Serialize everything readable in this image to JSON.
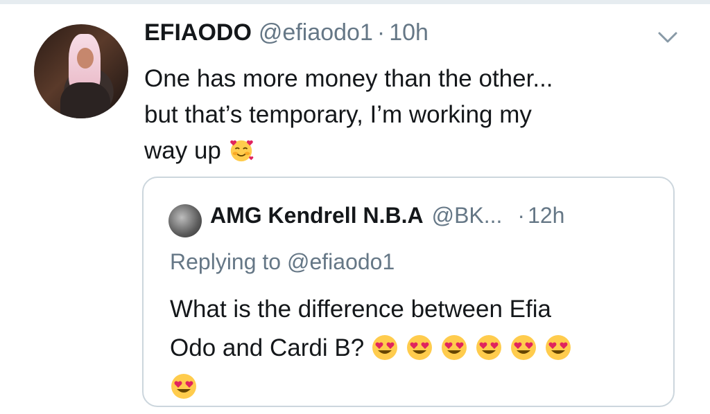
{
  "tweet": {
    "name": "EFIAODO",
    "handle": "@efiaodo1",
    "separator": "·",
    "time": "10h",
    "text_line1": "One has more money than the other...",
    "text_line2": "but that’s temporary, I’m working my",
    "text_line3": "way up",
    "emoji": "smiling-face-with-hearts"
  },
  "quoted_tweet": {
    "name": "AMG Kendrell N.B.A",
    "handle": "@BK...",
    "separator": "·",
    "time": "12h",
    "replying_to": "Replying to @efiaodo1",
    "text_line1": "What is the difference between Efia",
    "text_line2": "Odo and Cardi B?",
    "emoji": "heart-eyes",
    "emoji_count": 7
  },
  "colors": {
    "text": "#14171a",
    "secondary": "#657786",
    "border": "#ccd6dd"
  },
  "icons": [
    "chevron-down-icon"
  ]
}
